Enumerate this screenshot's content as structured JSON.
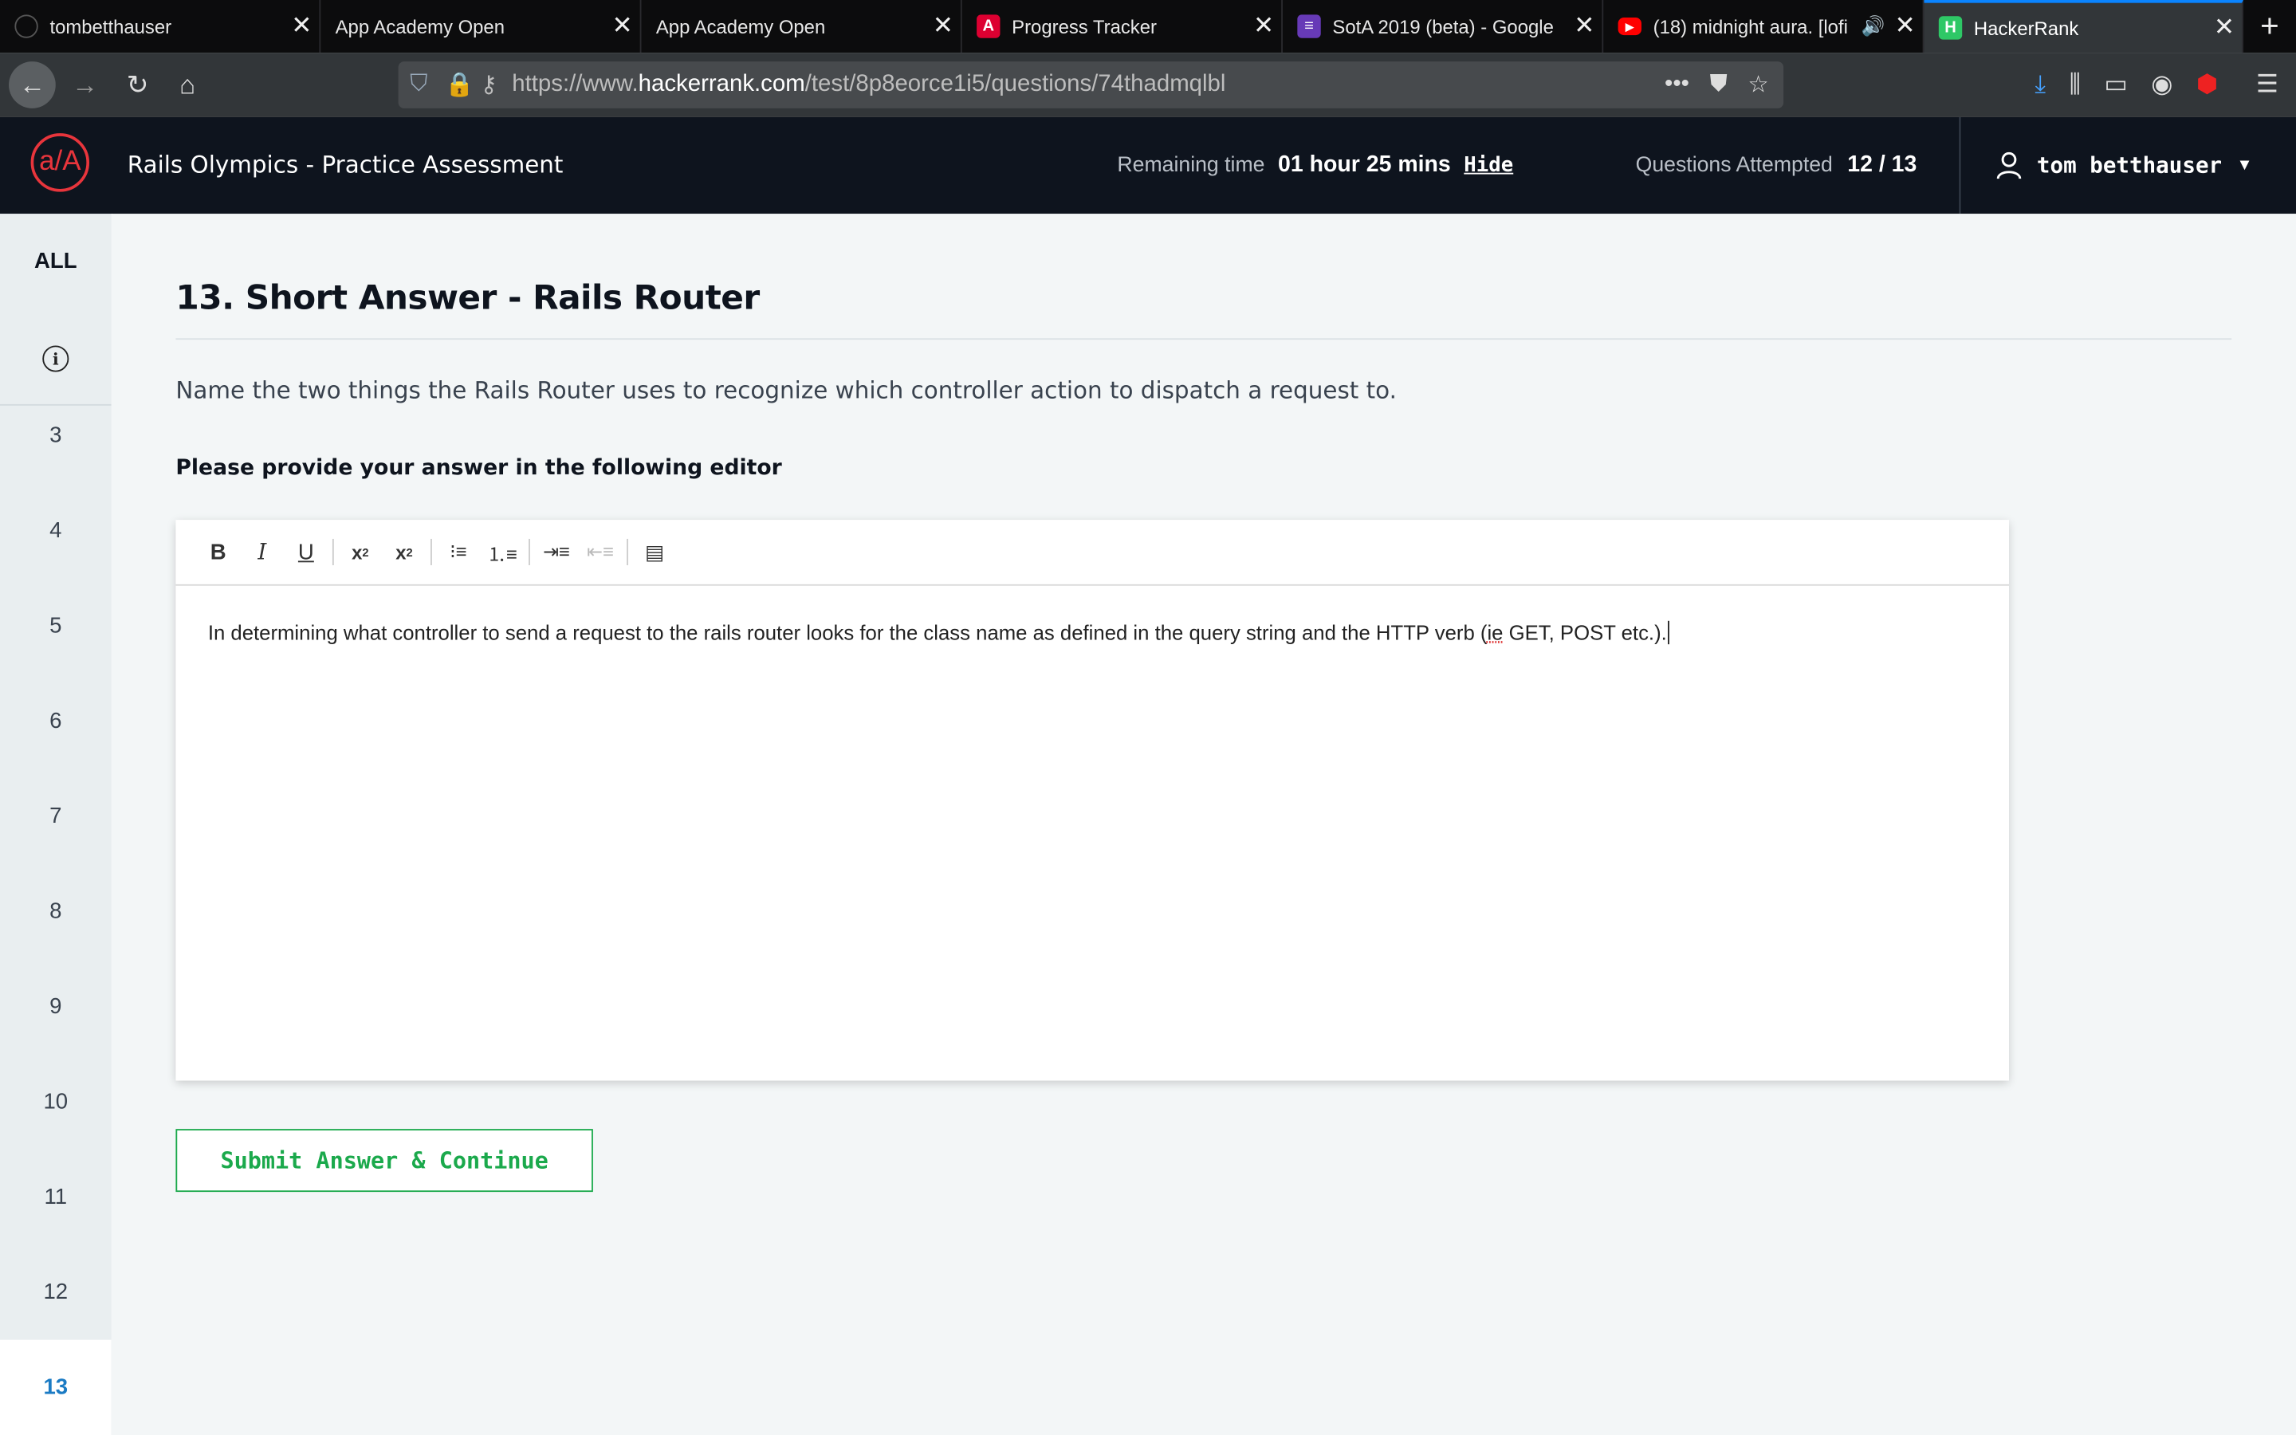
{
  "browser": {
    "tabs": [
      {
        "label": "tombetthauser",
        "icon": "github-icon"
      },
      {
        "label": "App Academy Open",
        "icon": "none"
      },
      {
        "label": "App Academy Open",
        "icon": "none"
      },
      {
        "label": "Progress Tracker",
        "icon": "angular-icon"
      },
      {
        "label": "SotA 2019 (beta) - Google",
        "icon": "google-forms-icon"
      },
      {
        "label": "(18) midnight aura. [lofi",
        "icon": "youtube-icon"
      },
      {
        "label": "HackerRank",
        "icon": "hackerrank-icon",
        "active": true
      }
    ],
    "url_prefix": "https://www.",
    "url_host": "hackerrank.com",
    "url_path": "/test/8p8eorce1i5/questions/74thadmqlbl"
  },
  "header": {
    "logo_text": "a/A",
    "title": "Rails Olympics - Practice Assessment",
    "remaining_label": "Remaining time",
    "remaining_value": "01 hour 25 mins",
    "hide_label": "Hide",
    "attempted_label": "Questions Attempted",
    "attempted_value": "12 / 13",
    "username": "tom betthauser"
  },
  "rail": {
    "all_label": "ALL",
    "questions": [
      "3",
      "4",
      "5",
      "6",
      "7",
      "8",
      "9",
      "10",
      "11",
      "12",
      "13"
    ],
    "active": "13"
  },
  "question": {
    "title": "13. Short Answer - Rails Router",
    "text": "Name the two things the Rails Router uses to recognize which controller action to dispatch a request to.",
    "prompt": "Please provide your answer in the following editor",
    "answer_before": "In determining what controller to send a request to the rails router looks for the class name as defined in the query string and the HTTP verb (",
    "answer_misspelled": "ie",
    "answer_after": " GET, POST etc.).",
    "submit_label": "Submit Answer & Continue"
  },
  "colors": {
    "accent_green": "#1ba94c",
    "header_bg": "#0e141e",
    "active_blue": "#1b7bc4",
    "brand_red": "#e8353c"
  }
}
